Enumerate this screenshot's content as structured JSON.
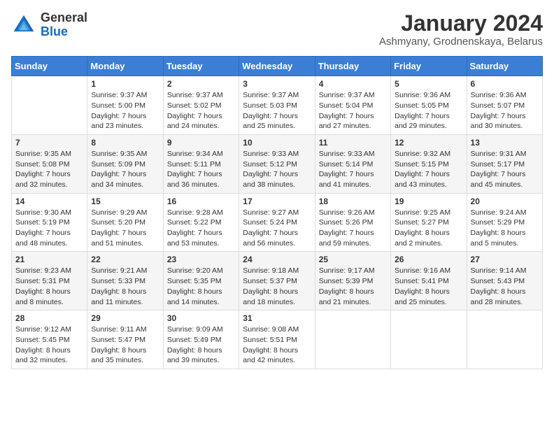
{
  "header": {
    "logo_line1": "General",
    "logo_line2": "Blue",
    "month_title": "January 2024",
    "location": "Ashmyany, Grodnenskaya, Belarus"
  },
  "weekdays": [
    "Sunday",
    "Monday",
    "Tuesday",
    "Wednesday",
    "Thursday",
    "Friday",
    "Saturday"
  ],
  "weeks": [
    [
      {
        "day": "",
        "info": ""
      },
      {
        "day": "1",
        "info": "Sunrise: 9:37 AM\nSunset: 5:00 PM\nDaylight: 7 hours\nand 23 minutes."
      },
      {
        "day": "2",
        "info": "Sunrise: 9:37 AM\nSunset: 5:02 PM\nDaylight: 7 hours\nand 24 minutes."
      },
      {
        "day": "3",
        "info": "Sunrise: 9:37 AM\nSunset: 5:03 PM\nDaylight: 7 hours\nand 25 minutes."
      },
      {
        "day": "4",
        "info": "Sunrise: 9:37 AM\nSunset: 5:04 PM\nDaylight: 7 hours\nand 27 minutes."
      },
      {
        "day": "5",
        "info": "Sunrise: 9:36 AM\nSunset: 5:05 PM\nDaylight: 7 hours\nand 29 minutes."
      },
      {
        "day": "6",
        "info": "Sunrise: 9:36 AM\nSunset: 5:07 PM\nDaylight: 7 hours\nand 30 minutes."
      }
    ],
    [
      {
        "day": "7",
        "info": "Sunrise: 9:35 AM\nSunset: 5:08 PM\nDaylight: 7 hours\nand 32 minutes."
      },
      {
        "day": "8",
        "info": "Sunrise: 9:35 AM\nSunset: 5:09 PM\nDaylight: 7 hours\nand 34 minutes."
      },
      {
        "day": "9",
        "info": "Sunrise: 9:34 AM\nSunset: 5:11 PM\nDaylight: 7 hours\nand 36 minutes."
      },
      {
        "day": "10",
        "info": "Sunrise: 9:33 AM\nSunset: 5:12 PM\nDaylight: 7 hours\nand 38 minutes."
      },
      {
        "day": "11",
        "info": "Sunrise: 9:33 AM\nSunset: 5:14 PM\nDaylight: 7 hours\nand 41 minutes."
      },
      {
        "day": "12",
        "info": "Sunrise: 9:32 AM\nSunset: 5:15 PM\nDaylight: 7 hours\nand 43 minutes."
      },
      {
        "day": "13",
        "info": "Sunrise: 9:31 AM\nSunset: 5:17 PM\nDaylight: 7 hours\nand 45 minutes."
      }
    ],
    [
      {
        "day": "14",
        "info": "Sunrise: 9:30 AM\nSunset: 5:19 PM\nDaylight: 7 hours\nand 48 minutes."
      },
      {
        "day": "15",
        "info": "Sunrise: 9:29 AM\nSunset: 5:20 PM\nDaylight: 7 hours\nand 51 minutes."
      },
      {
        "day": "16",
        "info": "Sunrise: 9:28 AM\nSunset: 5:22 PM\nDaylight: 7 hours\nand 53 minutes."
      },
      {
        "day": "17",
        "info": "Sunrise: 9:27 AM\nSunset: 5:24 PM\nDaylight: 7 hours\nand 56 minutes."
      },
      {
        "day": "18",
        "info": "Sunrise: 9:26 AM\nSunset: 5:26 PM\nDaylight: 7 hours\nand 59 minutes."
      },
      {
        "day": "19",
        "info": "Sunrise: 9:25 AM\nSunset: 5:27 PM\nDaylight: 8 hours\nand 2 minutes."
      },
      {
        "day": "20",
        "info": "Sunrise: 9:24 AM\nSunset: 5:29 PM\nDaylight: 8 hours\nand 5 minutes."
      }
    ],
    [
      {
        "day": "21",
        "info": "Sunrise: 9:23 AM\nSunset: 5:31 PM\nDaylight: 8 hours\nand 8 minutes."
      },
      {
        "day": "22",
        "info": "Sunrise: 9:21 AM\nSunset: 5:33 PM\nDaylight: 8 hours\nand 11 minutes."
      },
      {
        "day": "23",
        "info": "Sunrise: 9:20 AM\nSunset: 5:35 PM\nDaylight: 8 hours\nand 14 minutes."
      },
      {
        "day": "24",
        "info": "Sunrise: 9:18 AM\nSunset: 5:37 PM\nDaylight: 8 hours\nand 18 minutes."
      },
      {
        "day": "25",
        "info": "Sunrise: 9:17 AM\nSunset: 5:39 PM\nDaylight: 8 hours\nand 21 minutes."
      },
      {
        "day": "26",
        "info": "Sunrise: 9:16 AM\nSunset: 5:41 PM\nDaylight: 8 hours\nand 25 minutes."
      },
      {
        "day": "27",
        "info": "Sunrise: 9:14 AM\nSunset: 5:43 PM\nDaylight: 8 hours\nand 28 minutes."
      }
    ],
    [
      {
        "day": "28",
        "info": "Sunrise: 9:12 AM\nSunset: 5:45 PM\nDaylight: 8 hours\nand 32 minutes."
      },
      {
        "day": "29",
        "info": "Sunrise: 9:11 AM\nSunset: 5:47 PM\nDaylight: 8 hours\nand 35 minutes."
      },
      {
        "day": "30",
        "info": "Sunrise: 9:09 AM\nSunset: 5:49 PM\nDaylight: 8 hours\nand 39 minutes."
      },
      {
        "day": "31",
        "info": "Sunrise: 9:08 AM\nSunset: 5:51 PM\nDaylight: 8 hours\nand 42 minutes."
      },
      {
        "day": "",
        "info": ""
      },
      {
        "day": "",
        "info": ""
      },
      {
        "day": "",
        "info": ""
      }
    ]
  ]
}
